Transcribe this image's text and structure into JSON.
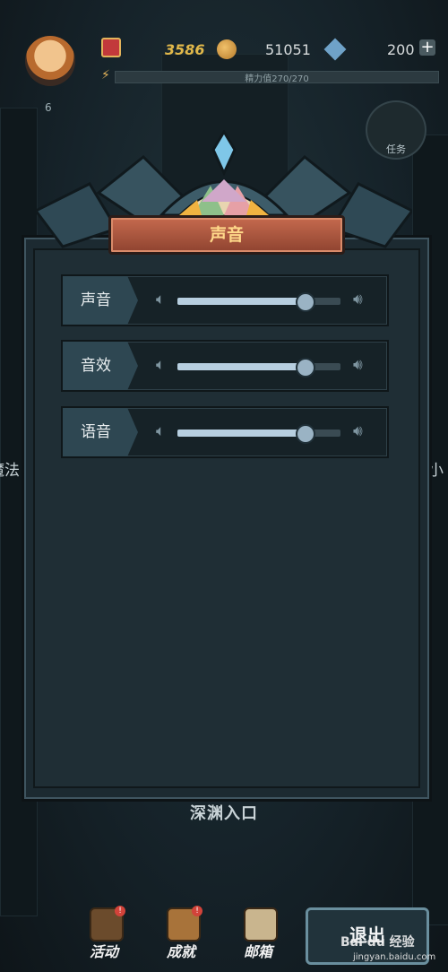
{
  "hud": {
    "level": "6",
    "gold": "3586",
    "coins": "51051",
    "gems": "200",
    "plus_symbol": "+",
    "energy_text": "精力值270/270",
    "task_label": "任务"
  },
  "side_labels": {
    "left": "魔法",
    "right": "小"
  },
  "dialog": {
    "title": "声音",
    "rows": [
      {
        "label": "声音",
        "level": 0.78
      },
      {
        "label": "音效",
        "level": 0.78
      },
      {
        "label": "语音",
        "level": 0.78
      }
    ]
  },
  "bottom": {
    "abyss_entrance": "深渊入口",
    "nav": [
      {
        "label": "活动",
        "badge": "!"
      },
      {
        "label": "成就",
        "badge": "!"
      },
      {
        "label": "邮箱",
        "badge": ""
      }
    ],
    "exit_label": "退出"
  },
  "watermark": {
    "logo": "Bai du 经验",
    "url": "jingyan.baidu.com"
  },
  "colors": {
    "title_text": "#ffd98a",
    "title_plate": "#b45a3e",
    "slider_fill": "#b7cfe0",
    "background": "#121b1f"
  },
  "icons": {
    "volume_low": "speaker-low-icon",
    "volume_high": "speaker-high-icon",
    "rank": "rank-banner-icon",
    "coin": "coin-icon",
    "gem": "gem-icon",
    "energy": "lightning-icon"
  }
}
